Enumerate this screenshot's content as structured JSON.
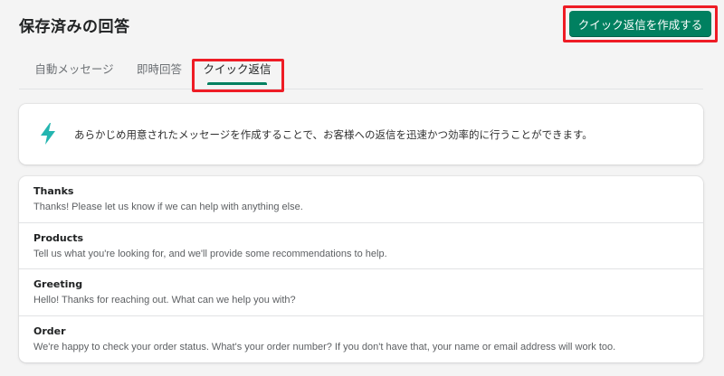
{
  "header": {
    "title": "保存済みの回答",
    "create_button_label": "クイック返信を作成する"
  },
  "tabs": [
    {
      "label": "自動メッセージ"
    },
    {
      "label": "即時回答"
    },
    {
      "label": "クイック返信",
      "active": true
    }
  ],
  "banner": {
    "icon": "lightning-bolt-icon",
    "icon_color": "#24b5b0",
    "text": "あらかじめ用意されたメッセージを作成することで、お客様への返信を迅速かつ効率的に行うことができます。"
  },
  "quick_replies": [
    {
      "title": "Thanks",
      "body": "Thanks! Please let us know if we can help with anything else."
    },
    {
      "title": "Products",
      "body": "Tell us what you're looking for, and we'll provide some recommendations to help."
    },
    {
      "title": "Greeting",
      "body": "Hello! Thanks for reaching out. What can we help you with?"
    },
    {
      "title": "Order",
      "body": "We're happy to check your order status. What's your order number? If you don't have that, your name or email address will work too."
    }
  ],
  "colors": {
    "primary": "#008060",
    "highlight_box": "#ee1c25",
    "background": "#f4f4f4"
  }
}
